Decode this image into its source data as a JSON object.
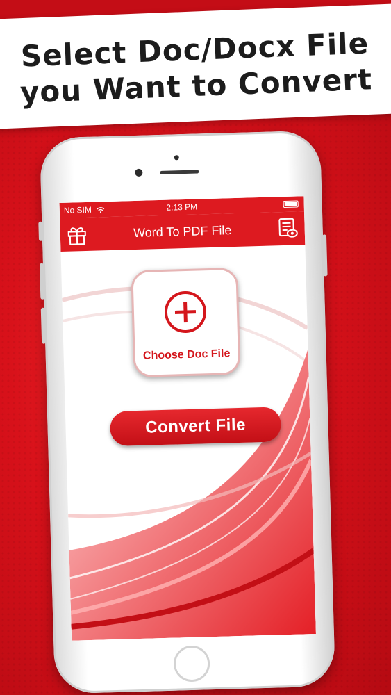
{
  "banner": {
    "line1": "Select Doc/Docx File",
    "line2": "you Want to Convert"
  },
  "status": {
    "carrier": "No SIM",
    "time": "2:13 PM"
  },
  "appbar": {
    "title": "Word To PDF File",
    "left_icon": "gift-icon",
    "right_icon": "document-view-icon"
  },
  "main": {
    "choose_label": "Choose Doc File",
    "choose_icon": "plus-circle-icon",
    "convert_label": "Convert File"
  },
  "colors": {
    "brand_red": "#dd1a20",
    "accent_red": "#d4161c",
    "background": "#d8111a"
  }
}
